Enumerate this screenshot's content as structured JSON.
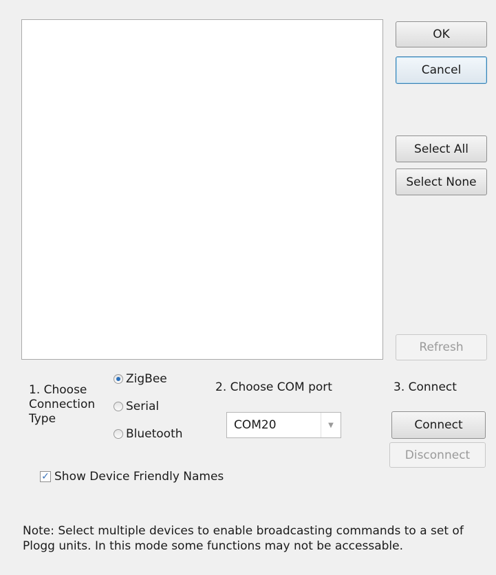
{
  "buttons": {
    "ok": "OK",
    "cancel": "Cancel",
    "select_all": "Select All",
    "select_none": "Select None",
    "refresh": "Refresh",
    "connect": "Connect",
    "disconnect": "Disconnect"
  },
  "connection_type": {
    "label_line1": "1. Choose",
    "label_line2": "Connection",
    "label_line3": "Type",
    "options": [
      "ZigBee",
      "Serial",
      "Bluetooth"
    ],
    "selected": "ZigBee"
  },
  "com_port": {
    "label": "2. Choose COM port",
    "value": "COM20"
  },
  "connect_section": {
    "label": "3. Connect"
  },
  "show_friendly_names": {
    "label": "Show Device Friendly Names",
    "checked": true
  },
  "note": {
    "line1": "Note: Select multiple devices to enable broadcasting commands to a set of",
    "line2": "Plogg units. In this mode some functions may not be accessable."
  },
  "colors": {
    "background": "#f0f0f0",
    "radio_accent": "#2a6fba",
    "default_button_border": "#3c7fb1"
  }
}
